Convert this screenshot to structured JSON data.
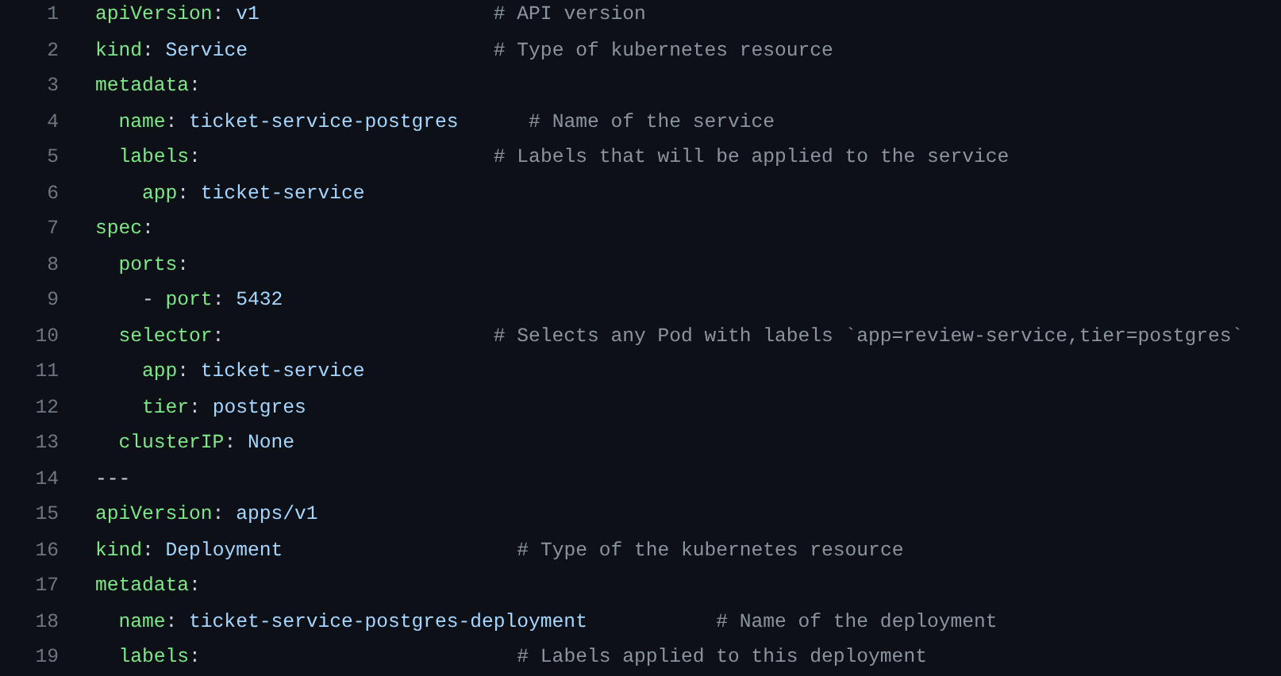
{
  "code_lines": [
    {
      "number": "1",
      "tokens": [
        {
          "kind": "key",
          "text": "apiVersion"
        },
        {
          "kind": "plain",
          "text": ": "
        },
        {
          "kind": "value",
          "text": "v1"
        },
        {
          "kind": "comment",
          "text": "                    # API version"
        }
      ]
    },
    {
      "number": "2",
      "tokens": [
        {
          "kind": "key",
          "text": "kind"
        },
        {
          "kind": "plain",
          "text": ": "
        },
        {
          "kind": "value",
          "text": "Service"
        },
        {
          "kind": "comment",
          "text": "                     # Type of kubernetes resource"
        }
      ]
    },
    {
      "number": "3",
      "tokens": [
        {
          "kind": "key",
          "text": "metadata"
        },
        {
          "kind": "plain",
          "text": ":"
        }
      ]
    },
    {
      "number": "4",
      "tokens": [
        {
          "kind": "key",
          "text": "  name"
        },
        {
          "kind": "plain",
          "text": ": "
        },
        {
          "kind": "value",
          "text": "ticket-service-postgres"
        },
        {
          "kind": "comment",
          "text": "      # Name of the service"
        }
      ]
    },
    {
      "number": "5",
      "tokens": [
        {
          "kind": "key",
          "text": "  labels"
        },
        {
          "kind": "plain",
          "text": ":                         "
        },
        {
          "kind": "comment",
          "text": "# Labels that will be applied to the service"
        }
      ]
    },
    {
      "number": "6",
      "tokens": [
        {
          "kind": "key",
          "text": "    app"
        },
        {
          "kind": "plain",
          "text": ": "
        },
        {
          "kind": "value",
          "text": "ticket-service"
        }
      ]
    },
    {
      "number": "7",
      "tokens": [
        {
          "kind": "key",
          "text": "spec"
        },
        {
          "kind": "plain",
          "text": ":"
        }
      ]
    },
    {
      "number": "8",
      "tokens": [
        {
          "kind": "key",
          "text": "  ports"
        },
        {
          "kind": "plain",
          "text": ":"
        }
      ]
    },
    {
      "number": "9",
      "tokens": [
        {
          "kind": "plain",
          "text": "    - "
        },
        {
          "kind": "key",
          "text": "port"
        },
        {
          "kind": "plain",
          "text": ": "
        },
        {
          "kind": "value",
          "text": "5432"
        }
      ]
    },
    {
      "number": "10",
      "tokens": [
        {
          "kind": "key",
          "text": "  selector"
        },
        {
          "kind": "plain",
          "text": ":                       "
        },
        {
          "kind": "comment",
          "text": "# Selects any Pod with labels `app=review-service,tier=postgres`"
        }
      ]
    },
    {
      "number": "11",
      "tokens": [
        {
          "kind": "key",
          "text": "    app"
        },
        {
          "kind": "plain",
          "text": ": "
        },
        {
          "kind": "value",
          "text": "ticket-service"
        }
      ]
    },
    {
      "number": "12",
      "tokens": [
        {
          "kind": "key",
          "text": "    tier"
        },
        {
          "kind": "plain",
          "text": ": "
        },
        {
          "kind": "value",
          "text": "postgres"
        }
      ]
    },
    {
      "number": "13",
      "tokens": [
        {
          "kind": "key",
          "text": "  clusterIP"
        },
        {
          "kind": "plain",
          "text": ": "
        },
        {
          "kind": "value",
          "text": "None"
        }
      ]
    },
    {
      "number": "14",
      "tokens": [
        {
          "kind": "plain",
          "text": "---"
        }
      ]
    },
    {
      "number": "15",
      "tokens": [
        {
          "kind": "key",
          "text": "apiVersion"
        },
        {
          "kind": "plain",
          "text": ": "
        },
        {
          "kind": "value",
          "text": "apps/v1"
        }
      ]
    },
    {
      "number": "16",
      "tokens": [
        {
          "kind": "key",
          "text": "kind"
        },
        {
          "kind": "plain",
          "text": ": "
        },
        {
          "kind": "value",
          "text": "Deployment"
        },
        {
          "kind": "comment",
          "text": "                    # Type of the kubernetes resource"
        }
      ]
    },
    {
      "number": "17",
      "tokens": [
        {
          "kind": "key",
          "text": "metadata"
        },
        {
          "kind": "plain",
          "text": ":"
        }
      ]
    },
    {
      "number": "18",
      "tokens": [
        {
          "kind": "key",
          "text": "  name"
        },
        {
          "kind": "plain",
          "text": ": "
        },
        {
          "kind": "value",
          "text": "ticket-service-postgres-deployment"
        },
        {
          "kind": "comment",
          "text": "           # Name of the deployment"
        }
      ]
    },
    {
      "number": "19",
      "tokens": [
        {
          "kind": "key",
          "text": "  labels"
        },
        {
          "kind": "plain",
          "text": ":                           "
        },
        {
          "kind": "comment",
          "text": "# Labels applied to this deployment"
        }
      ]
    }
  ]
}
